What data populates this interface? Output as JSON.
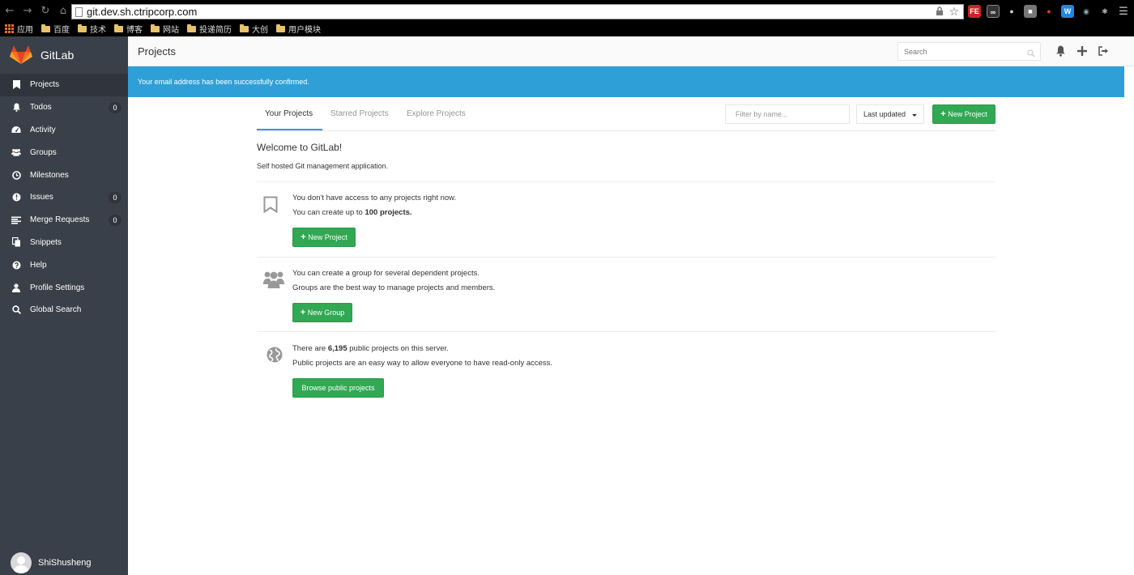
{
  "browser": {
    "url": "git.dev.sh.ctripcorp.com",
    "bookmarks": [
      {
        "label": "应用",
        "type": "apps"
      },
      {
        "label": "百度",
        "type": "folder"
      },
      {
        "label": "技术",
        "type": "folder"
      },
      {
        "label": "博客",
        "type": "folder"
      },
      {
        "label": "网站",
        "type": "folder"
      },
      {
        "label": "投递简历",
        "type": "folder"
      },
      {
        "label": "大创",
        "type": "folder"
      },
      {
        "label": "用户模块",
        "type": "folder"
      }
    ],
    "ext_badge": "FE"
  },
  "sidebar": {
    "brand": "GitLab",
    "items": [
      {
        "label": "Projects",
        "icon": "bookmark-icon",
        "active": true
      },
      {
        "label": "Todos",
        "icon": "bell-icon",
        "count": "0"
      },
      {
        "label": "Activity",
        "icon": "dashboard-icon"
      },
      {
        "label": "Groups",
        "icon": "users-icon"
      },
      {
        "label": "Milestones",
        "icon": "clock-icon"
      },
      {
        "label": "Issues",
        "icon": "exclamation-circle-icon",
        "count": "0"
      },
      {
        "label": "Merge Requests",
        "icon": "list-icon",
        "count": "0"
      },
      {
        "label": "Snippets",
        "icon": "copy-icon"
      },
      {
        "label": "Help",
        "icon": "question-circle-icon"
      },
      {
        "label": "Profile Settings",
        "icon": "user-icon"
      },
      {
        "label": "Global Search",
        "icon": "search-icon"
      }
    ],
    "user_name": "ShiShusheng"
  },
  "header": {
    "title": "Projects",
    "search_placeholder": "Search"
  },
  "flash": {
    "message": "Your email address has been successfully confirmed."
  },
  "tabs": {
    "your_projects": "Your Projects",
    "starred_projects": "Starred Projects",
    "explore_projects": "Explore Projects"
  },
  "toolbar": {
    "filter_placeholder": "Filter by name...",
    "sort_label": "Last updated",
    "new_project_label": "New Project"
  },
  "welcome": {
    "title": "Welcome to GitLab!",
    "subtitle": "Self hosted Git management application."
  },
  "blocks": {
    "projects": {
      "line1": "You don't have access to any projects right now.",
      "line2_prefix": "You can create up to ",
      "line2_strong": "100 projects.",
      "button": "New Project"
    },
    "groups": {
      "line1": "You can create a group for several dependent projects.",
      "line2": "Groups are the best way to manage projects and members.",
      "button": "New Group"
    },
    "public": {
      "line1_prefix": "There are ",
      "line1_strong": "6,195",
      "line1_suffix": " public projects on this server.",
      "line2": "Public projects are an easy way to allow everyone to have read-only access.",
      "button": "Browse public projects"
    }
  },
  "colors": {
    "sidebar_bg": "#394049",
    "flash_bg": "#2fa0d7",
    "primary_green": "#31a853",
    "tab_active": "#4a8bee"
  }
}
